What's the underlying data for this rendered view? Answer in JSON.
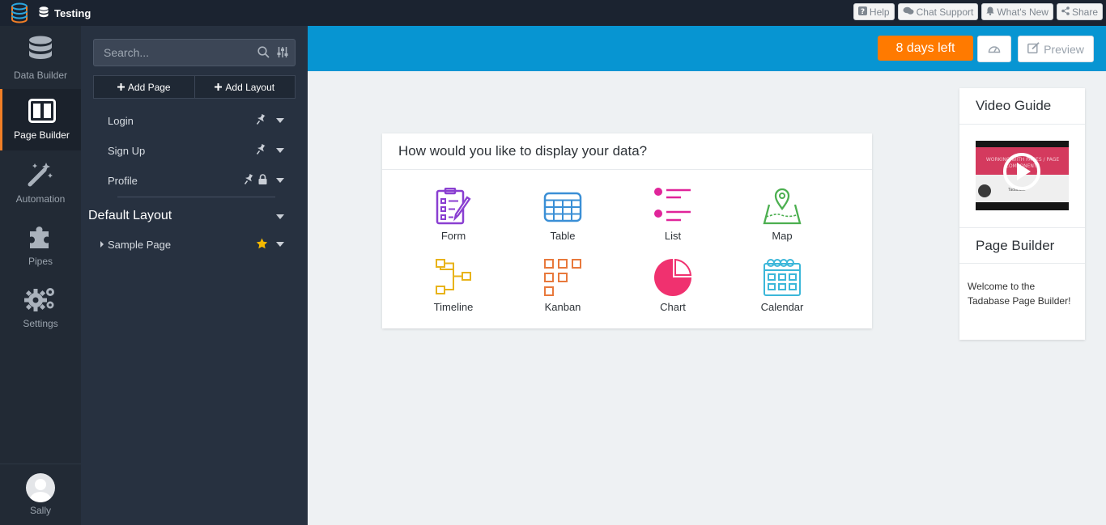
{
  "app": {
    "name": "Testing"
  },
  "top_actions": {
    "help": "Help",
    "chat": "Chat Support",
    "whats_new": "What's New",
    "share": "Share"
  },
  "left_nav": {
    "items": [
      {
        "label": "Data Builder",
        "icon": "database-icon"
      },
      {
        "label": "Page Builder",
        "icon": "layout-icon",
        "active": true
      },
      {
        "label": "Automation",
        "icon": "magic-wand-icon"
      },
      {
        "label": "Pipes",
        "icon": "puzzle-icon"
      },
      {
        "label": "Settings",
        "icon": "gears-icon"
      }
    ],
    "user": "Sally"
  },
  "panel": {
    "search_placeholder": "Search...",
    "add_page": "Add Page",
    "add_layout": "Add Layout",
    "pages": [
      {
        "name": "Login"
      },
      {
        "name": "Sign Up"
      },
      {
        "name": "Profile"
      }
    ],
    "layout_title": "Default Layout",
    "layout_pages": [
      {
        "name": "Sample Page"
      }
    ]
  },
  "header": {
    "trial": "8 days left",
    "preview": "Preview"
  },
  "chooser": {
    "title": "How would you like to display your data?",
    "options": [
      {
        "label": "Form",
        "color": "#8a3fd1"
      },
      {
        "label": "Table",
        "color": "#3a8fd6"
      },
      {
        "label": "List",
        "color": "#e0259a"
      },
      {
        "label": "Map",
        "color": "#4caf50"
      },
      {
        "label": "Timeline",
        "color": "#e8b31a"
      },
      {
        "label": "Kanban",
        "color": "#e8793c"
      },
      {
        "label": "Chart",
        "color": "#f0316f"
      },
      {
        "label": "Calendar",
        "color": "#3cb7d9"
      }
    ]
  },
  "guide": {
    "title": "Video Guide",
    "video_caption": "WORKING WITH PAGES / PAGE COMPONENTS",
    "video_brand": "Tadabase",
    "section_title": "Page Builder",
    "text": "Welcome to the Tadabase Page Builder!"
  },
  "colors": {
    "accent_orange": "#ff7a00",
    "header_blue": "#0795d2",
    "sidebar_dark": "#222a35",
    "star": "#f5b800"
  }
}
